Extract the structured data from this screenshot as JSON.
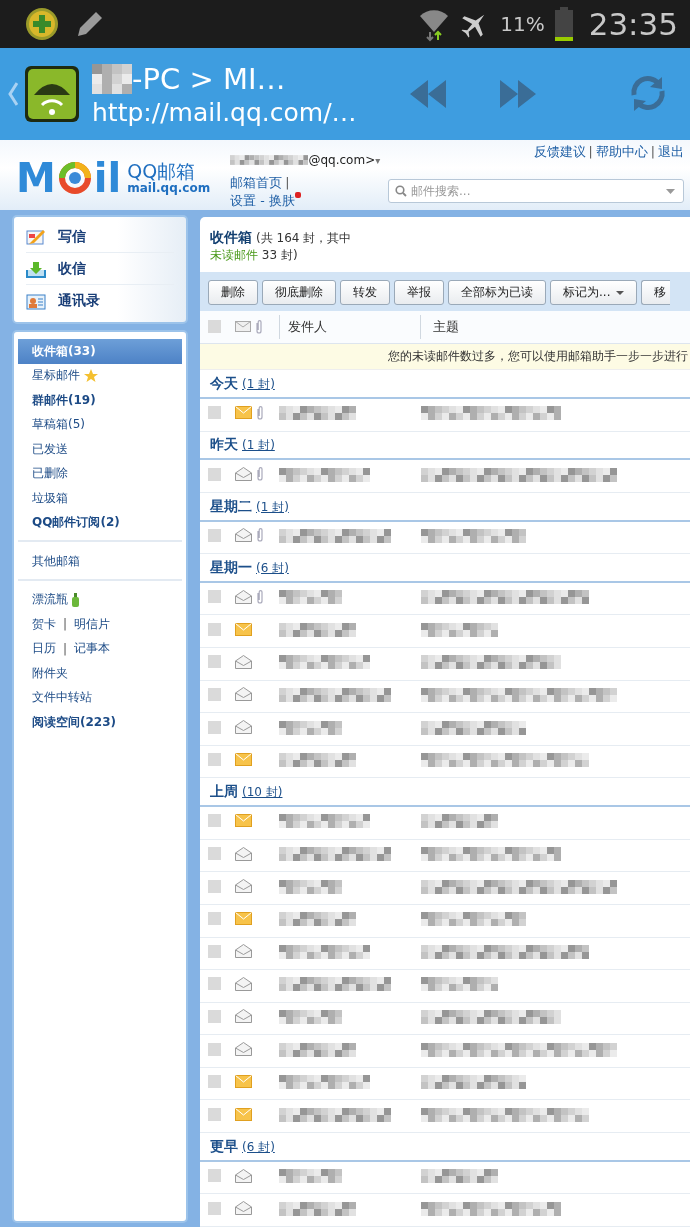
{
  "status_bar": {
    "battery": "11%",
    "time": "23:35"
  },
  "app_bar": {
    "title": "-PC > MI…",
    "url": "http://mail.qq.com/…"
  },
  "header": {
    "logo": {
      "left": "M",
      "right": "il",
      "name": "QQ邮箱",
      "domain": "mail.qq.com"
    },
    "account": "@qq.com>",
    "account_caret": "▾",
    "nav_links": [
      "邮箱首页",
      "设置 - 换肤"
    ],
    "separator": "|",
    "top_links": [
      "反馈建议",
      "帮助中心",
      "退出"
    ],
    "search": {
      "placeholder": "邮件搜索..."
    }
  },
  "sidebar": {
    "actions": [
      {
        "kind": "compose",
        "label": "写信"
      },
      {
        "kind": "receive",
        "label": "收信"
      },
      {
        "kind": "contacts",
        "label": "通讯录"
      }
    ],
    "groups": [
      {
        "items": [
          {
            "kind": "plain",
            "label": "收件箱(33)",
            "selected": true,
            "bold": true
          },
          {
            "kind": "star",
            "label": "星标邮件",
            "selected": false,
            "bold": false
          },
          {
            "kind": "plain",
            "label": "群邮件(19)",
            "selected": false,
            "bold": true
          },
          {
            "kind": "plain",
            "label": "草稿箱(5)",
            "selected": false,
            "bold": false
          },
          {
            "kind": "plain",
            "label": "已发送",
            "selected": false,
            "bold": false
          },
          {
            "kind": "plain",
            "label": "已删除",
            "selected": false,
            "bold": false
          },
          {
            "kind": "plain",
            "label": "垃圾箱",
            "selected": false,
            "bold": false
          },
          {
            "kind": "plain",
            "label": "QQ邮件订阅(2)",
            "selected": false,
            "bold": true
          }
        ]
      },
      {
        "items": [
          {
            "kind": "plain",
            "label": "其他邮箱",
            "selected": false,
            "bold": false
          }
        ]
      },
      {
        "items": [
          {
            "kind": "bottle",
            "label": "漂流瓶",
            "selected": false,
            "bold": false
          },
          {
            "kind": "pair",
            "labels": [
              "贺卡",
              "明信片"
            ],
            "separator": "|",
            "selected": false,
            "bold": false
          },
          {
            "kind": "pair",
            "labels": [
              "日历",
              "记事本"
            ],
            "separator": "|",
            "selected": false,
            "bold": false
          },
          {
            "kind": "plain",
            "label": "附件夹",
            "selected": false,
            "bold": false
          },
          {
            "kind": "plain",
            "label": "文件中转站",
            "selected": false,
            "bold": false
          },
          {
            "kind": "plain",
            "label": "阅读空间(223)",
            "selected": false,
            "bold": true
          }
        ]
      }
    ]
  },
  "mailbox": {
    "title": "收件箱",
    "summary_prefix": "(共 164 封，其中",
    "unread_label": "未读邮件",
    "summary_suffix": " 33 封)",
    "toolbar": [
      {
        "kind": "button",
        "label": "删除"
      },
      {
        "kind": "button",
        "label": "彻底删除"
      },
      {
        "kind": "button",
        "label": "转发"
      },
      {
        "kind": "button",
        "label": "举报"
      },
      {
        "kind": "button",
        "label": "全部标为已读"
      },
      {
        "kind": "dropdown",
        "label": "标记为..."
      },
      {
        "kind": "button",
        "label": "移"
      }
    ],
    "select_all_checked": false,
    "columns": [
      "发件人",
      "主题"
    ],
    "notice": "您的未读邮件数过多，您可以使用邮箱助手一步一步进行",
    "groups": [
      {
        "label": "今天",
        "count": "(1 封)",
        "emails": [
          {
            "checked": false,
            "unread": true,
            "attachment": true
          }
        ]
      },
      {
        "label": "昨天",
        "count": "(1 封)",
        "emails": [
          {
            "checked": false,
            "unread": false,
            "attachment": true
          }
        ]
      },
      {
        "label": "星期二",
        "count": "(1 封)",
        "emails": [
          {
            "checked": false,
            "unread": false,
            "attachment": true
          }
        ]
      },
      {
        "label": "星期一",
        "count": "(6 封)",
        "emails": [
          {
            "checked": false,
            "unread": false,
            "attachment": true
          },
          {
            "checked": false,
            "unread": true,
            "attachment": false
          },
          {
            "checked": false,
            "unread": false,
            "attachment": false
          },
          {
            "checked": false,
            "unread": false,
            "attachment": false
          },
          {
            "checked": false,
            "unread": false,
            "attachment": false
          },
          {
            "checked": false,
            "unread": true,
            "attachment": false
          }
        ]
      },
      {
        "label": "上周",
        "count": "(10 封)",
        "emails": [
          {
            "checked": false,
            "unread": true,
            "attachment": false
          },
          {
            "checked": false,
            "unread": false,
            "attachment": false
          },
          {
            "checked": false,
            "unread": false,
            "attachment": false
          },
          {
            "checked": false,
            "unread": true,
            "attachment": false
          },
          {
            "checked": false,
            "unread": false,
            "attachment": false
          },
          {
            "checked": false,
            "unread": false,
            "attachment": false
          },
          {
            "checked": false,
            "unread": false,
            "attachment": false
          },
          {
            "checked": false,
            "unread": false,
            "attachment": false
          },
          {
            "checked": false,
            "unread": true,
            "attachment": false
          },
          {
            "checked": false,
            "unread": true,
            "attachment": false
          }
        ]
      },
      {
        "label": "更早",
        "count": "(6 封)",
        "emails": [
          {
            "checked": false,
            "unread": false,
            "attachment": false
          },
          {
            "checked": false,
            "unread": false,
            "attachment": false
          }
        ]
      }
    ]
  }
}
